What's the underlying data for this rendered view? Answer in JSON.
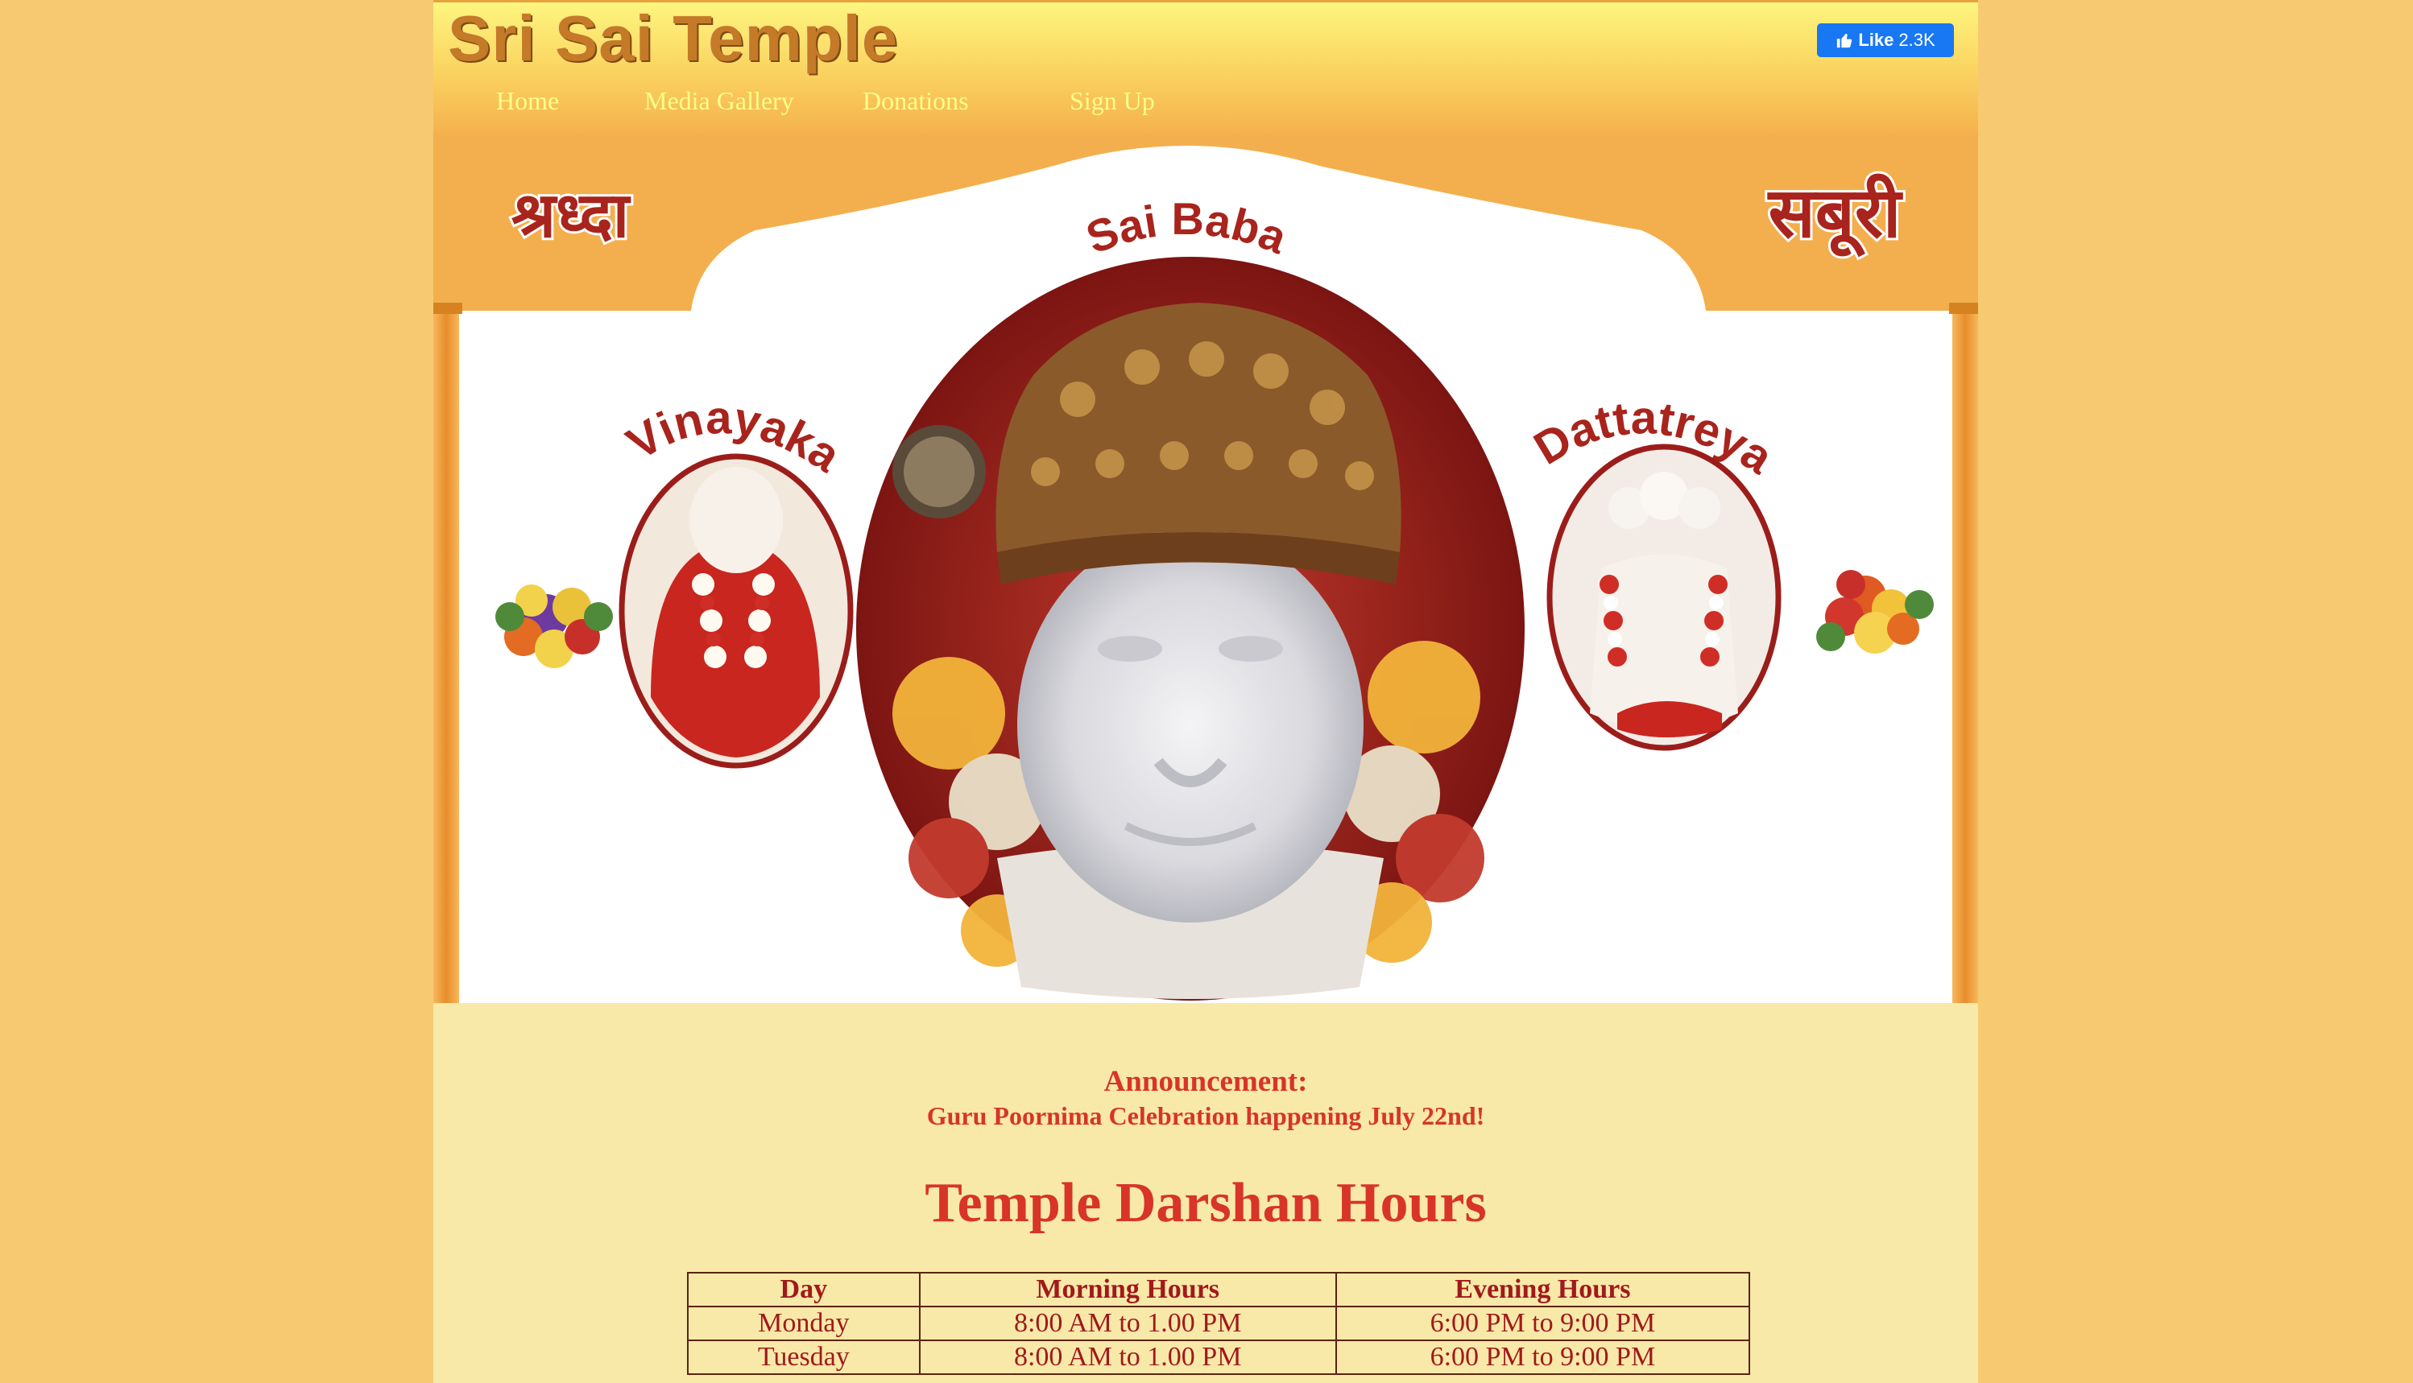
{
  "site": {
    "title": "Sri Sai Temple"
  },
  "facebook": {
    "like_label": "Like",
    "like_count": "2.3K"
  },
  "nav": {
    "items": [
      {
        "label": "Home"
      },
      {
        "label": "Media Gallery"
      },
      {
        "label": "Donations"
      },
      {
        "label": "Sign Up"
      }
    ]
  },
  "banner": {
    "left_word": "श्रध्दा",
    "right_word": "सबूरी",
    "center_caption": "Sai Baba",
    "left_caption": "Vinayaka",
    "right_caption": "Dattatreya"
  },
  "announcement": {
    "heading": "Announcement:",
    "text": "Guru Poornima Celebration happening July 22nd!"
  },
  "hours": {
    "title": "Temple Darshan Hours",
    "columns": [
      "Day",
      "Morning Hours",
      "Evening Hours"
    ],
    "rows": [
      {
        "day": "Monday",
        "morning": "8:00 AM to 1.00 PM",
        "evening": "6:00 PM to 9:00 PM"
      },
      {
        "day": "Tuesday",
        "morning": "8:00 AM to 1.00 PM",
        "evening": "6:00 PM to 9:00 PM"
      }
    ]
  },
  "colors": {
    "background": "#f7ca71",
    "content_bg": "#f8e9a9",
    "accent_red": "#d83428",
    "nav_text": "#fdfd8b",
    "facebook_blue": "#1877f2"
  }
}
